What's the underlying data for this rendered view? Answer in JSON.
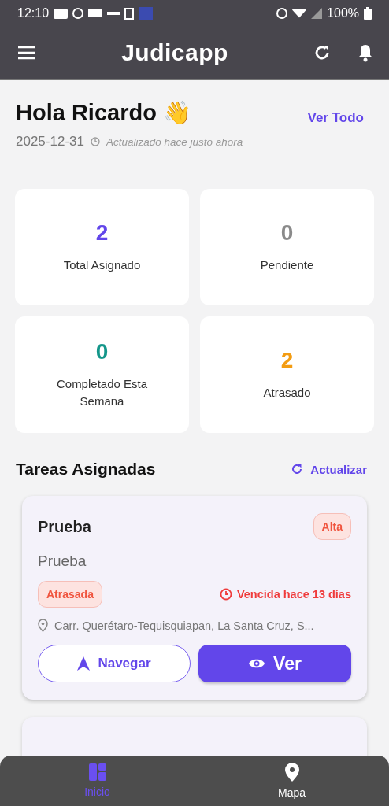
{
  "status_bar": {
    "time": "12:10",
    "battery": "100%"
  },
  "app_bar": {
    "title": "Judicapp"
  },
  "greeting": {
    "title": "Hola Ricardo 👋",
    "link": "Ver Todo",
    "date": "2025-12-31",
    "updated": "Actualizado hace justo ahora"
  },
  "stats": [
    {
      "value": "2",
      "label": "Total Asignado",
      "color": "#6246ea"
    },
    {
      "value": "0",
      "label": "Pendiente",
      "color": "#8a8a8a"
    },
    {
      "value": "0",
      "label": "Completado Esta Semana",
      "color": "#14968a"
    },
    {
      "value": "2",
      "label": "Atrasado",
      "color": "#f39c12"
    }
  ],
  "tasks_section": {
    "title": "Tareas Asignadas",
    "action": "Actualizar"
  },
  "tasks": [
    {
      "title": "Prueba",
      "priority": "Alta",
      "description": "Prueba",
      "status": "Atrasada",
      "due": "Vencida hace 13 días",
      "address": "Carr. Querétaro-Tequisquiapan, La Santa Cruz, S...",
      "buttons": [
        "Navegar",
        "Ver"
      ]
    }
  ],
  "bottom_nav": [
    {
      "label": "Inicio",
      "selected": true
    },
    {
      "label": "Mapa",
      "selected": false
    }
  ]
}
